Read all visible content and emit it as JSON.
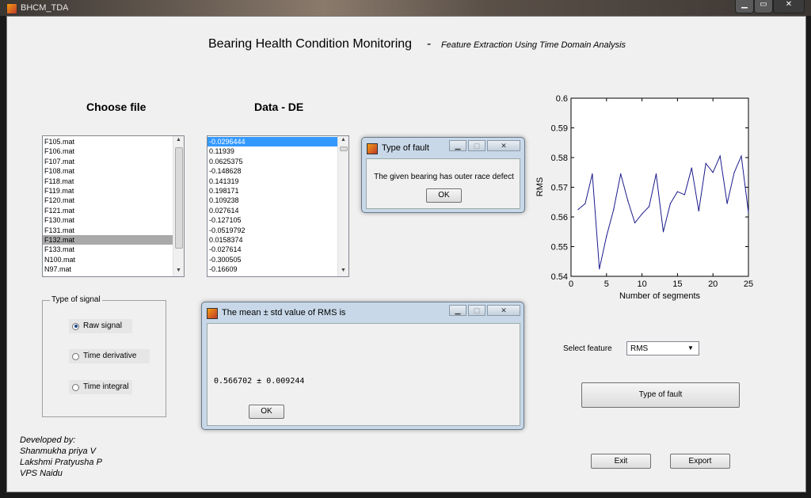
{
  "window": {
    "title": "BHCM_TDA"
  },
  "header": {
    "title": "Bearing Health Condition Monitoring",
    "separator": "-",
    "subtitle": "Feature Extraction Using Time Domain Analysis"
  },
  "file_panel": {
    "heading": "Choose file",
    "items": [
      "F105.mat",
      "F106.mat",
      "F107.mat",
      "F108.mat",
      "F118.mat",
      "F119.mat",
      "F120.mat",
      "F121.mat",
      "F130.mat",
      "F131.mat",
      "F132.mat",
      "F133.mat",
      "N100.mat",
      "N97.mat"
    ],
    "selected_index": 10
  },
  "data_panel": {
    "heading": "Data - DE",
    "items": [
      "-0.0296444",
      "0.11939",
      "0.0625375",
      "-0.148628",
      "0.141319",
      "0.198171",
      "0.109238",
      "0.027614",
      "-0.127105",
      "-0.0519792",
      "0.0158374",
      "-0.027614",
      "-0.300505",
      "-0.16609"
    ],
    "selected_index": 0
  },
  "signal_group": {
    "title": "Type of signal",
    "options": [
      "Raw signal",
      "Time derivative",
      "Time integral"
    ],
    "selected_index": 0
  },
  "fault_dialog": {
    "title": "Type of fault",
    "message": "The given bearing has outer race defect",
    "ok_label": "OK"
  },
  "rms_dialog": {
    "title": "The mean ± std value of RMS is",
    "value": "0.566702 ± 0.009244",
    "ok_label": "OK"
  },
  "feature": {
    "label": "Select feature",
    "selected": "RMS"
  },
  "buttons": {
    "type_of_fault": "Type of fault",
    "exit": "Exit",
    "export": "Export"
  },
  "credits": {
    "heading": "Developed by:",
    "names": [
      "Shanmukha priya V",
      "Lakshmi Pratyusha P",
      "VPS Naidu"
    ]
  },
  "colors": {
    "line": "#1a1a8c",
    "selection_blue": "#3399ff",
    "selection_grey": "#a9a9a9"
  },
  "chart_data": {
    "type": "line",
    "xlabel": "Number of segments",
    "ylabel": "RMS",
    "xlim": [
      0,
      25
    ],
    "ylim": [
      0.54,
      0.6
    ],
    "xticks": [
      0,
      5,
      10,
      15,
      20,
      25
    ],
    "yticks": [
      0.54,
      0.55,
      0.56,
      0.57,
      0.58,
      0.59,
      0.6
    ],
    "x": [
      1,
      2,
      3,
      4,
      5,
      6,
      7,
      8,
      9,
      10,
      11,
      12,
      13,
      14,
      15,
      16,
      17,
      18,
      19,
      20,
      21,
      22,
      23,
      24,
      25
    ],
    "y": [
      0.5625,
      0.5645,
      0.5745,
      0.5425,
      0.5535,
      0.5625,
      0.5745,
      0.5655,
      0.558,
      0.561,
      0.5635,
      0.5745,
      0.555,
      0.5645,
      0.5685,
      0.5675,
      0.5765,
      0.562,
      0.578,
      0.575,
      0.5805,
      0.5645,
      0.575,
      0.5805,
      0.5615
    ],
    "grid": false
  }
}
